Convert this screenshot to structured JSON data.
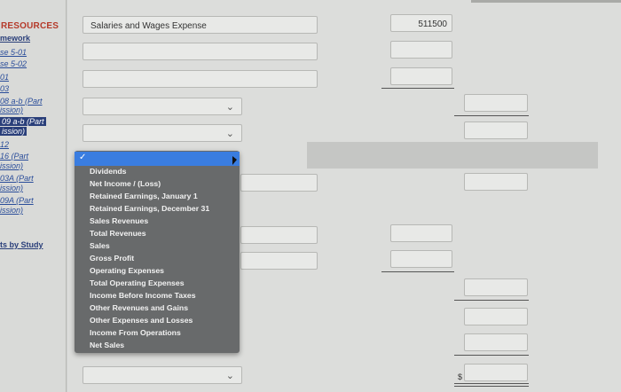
{
  "sidebar": {
    "heading": "RESOURCES",
    "items": [
      "mework",
      "se 5-01",
      "se 5-02",
      "01",
      "03",
      "08 a-b (Part",
      "ission)",
      "09 a-b (Part",
      "ission)",
      "12",
      "16 (Part",
      "ission)",
      "03A (Part",
      "ission)",
      "09A (Part",
      "ission)",
      "ts by Study"
    ]
  },
  "form": {
    "row1_label": "Salaries and Wages Expense",
    "row1_amount": "511500",
    "dollar_sign": "$"
  },
  "dropdown": {
    "options": [
      "Dividends",
      "Net Income / (Loss)",
      "Retained Earnings, January 1",
      "Retained Earnings, December 31",
      "Sales Revenues",
      "Total Revenues",
      "Sales",
      "Gross Profit",
      "Operating Expenses",
      "Total Operating Expenses",
      "Income Before Income Taxes",
      "Other Revenues and Gains",
      "Other Expenses and Losses",
      "Income From Operations",
      "Net Sales"
    ],
    "highlight_color": "#3a7de0"
  }
}
